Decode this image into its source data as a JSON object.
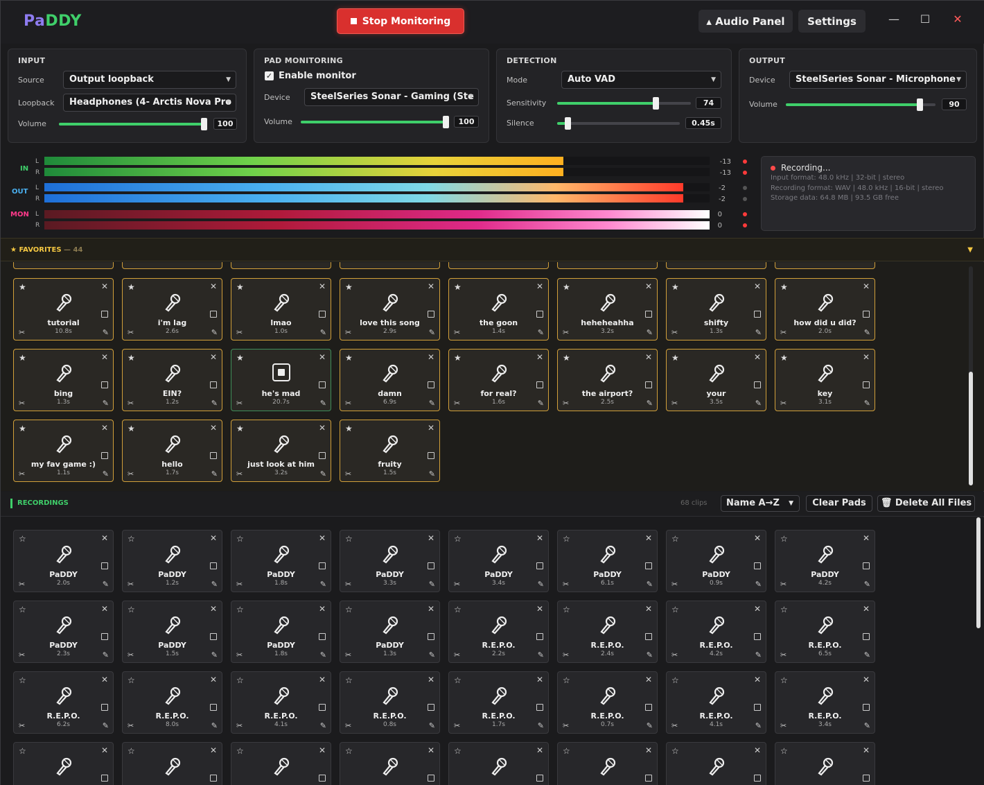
{
  "app": {
    "logo_a": "Pa",
    "logo_b": "DDY"
  },
  "titlebar": {
    "stop_label": "Stop Monitoring",
    "audio_panel_label": "▴ Audio Panel",
    "settings_label": "Settings",
    "minimize": "—",
    "maximize": "☐",
    "close": "✕"
  },
  "input": {
    "title": "INPUT",
    "source_label": "Source",
    "source_value": "Output loopback",
    "loopback_label": "Loopback",
    "loopback_value": "Headphones (4- Arctis Nova Pro",
    "volume_label": "Volume",
    "volume": "100",
    "volume_level": 100
  },
  "pad_monitoring": {
    "title": "PAD MONITORING",
    "enable_label": "Enable monitor",
    "enabled": true,
    "device_label": "Device",
    "device_value": "SteelSeries Sonar - Gaming (Ste",
    "volume_label": "Volume",
    "volume": "100",
    "volume_level": 100
  },
  "detection": {
    "title": "DETECTION",
    "mode_label": "Mode",
    "mode_value": "Auto VAD",
    "sensitivity_label": "Sensitivity",
    "sensitivity": "74",
    "sensitivity_level": 74,
    "silence_label": "Silence",
    "silence": "0.45s",
    "silence_level": 0.09
  },
  "output": {
    "title": "OUTPUT",
    "device_label": "Device",
    "device_value": "SteelSeries Sonar - Microphone",
    "volume_label": "Volume",
    "volume": "90",
    "volume_level": 90
  },
  "meters": {
    "in_label": "IN",
    "out_label": "OUT",
    "mon_label": "MON",
    "l": "L",
    "r": "R",
    "in_l_db": "-13",
    "in_r_db": "-13",
    "out_l_db": "-2",
    "out_r_db": "-2",
    "mon_l_db": "0",
    "mon_r_db": "0",
    "in_level": 0.78,
    "out_level": 0.96,
    "mon_level": 1.0
  },
  "recording_status": {
    "title": "Recording...",
    "input_format": "Input format: 48.0 kHz | 32-bit | stereo",
    "recording_format": "Recording format: WAV | 48.0 kHz | 16-bit | stereo",
    "storage": "Storage data: 64.8 MB | 93.5 GB free"
  },
  "favorites": {
    "title": "★ FAVORITES",
    "count": " — 44",
    "collapse": "▼",
    "pads": [
      {
        "name": "tutorial",
        "dur": "10.8s"
      },
      {
        "name": "i'm lag",
        "dur": "2.6s"
      },
      {
        "name": "lmao",
        "dur": "1.0s"
      },
      {
        "name": "love this song",
        "dur": "2.9s"
      },
      {
        "name": "the goon",
        "dur": "1.4s"
      },
      {
        "name": "heheheahha",
        "dur": "3.2s"
      },
      {
        "name": "shifty",
        "dur": "1.3s"
      },
      {
        "name": "how did u did?",
        "dur": "2.0s"
      },
      {
        "name": "bing",
        "dur": "1.3s"
      },
      {
        "name": "EIN?",
        "dur": "1.2s"
      },
      {
        "name": "he's mad",
        "dur": "20.7s",
        "playing": true
      },
      {
        "name": "damn",
        "dur": "6.9s"
      },
      {
        "name": "for real?",
        "dur": "1.6s"
      },
      {
        "name": "the airport?",
        "dur": "2.5s"
      },
      {
        "name": "your",
        "dur": "3.5s"
      },
      {
        "name": "key",
        "dur": "3.1s"
      },
      {
        "name": "my fav game :)",
        "dur": "1.1s"
      },
      {
        "name": "hello",
        "dur": "1.7s"
      },
      {
        "name": "just look at him",
        "dur": "3.2s"
      },
      {
        "name": "fruity",
        "dur": "1.5s"
      }
    ]
  },
  "recordings": {
    "title": "RECORDINGS",
    "count": "68 clips",
    "sort_value": "Name A→Z",
    "clear_label": "Clear Pads",
    "delete_label": "🗑 Delete All Files",
    "pads": [
      {
        "name": "PaDDY",
        "dur": "2.0s"
      },
      {
        "name": "PaDDY",
        "dur": "1.2s"
      },
      {
        "name": "PaDDY",
        "dur": "1.8s"
      },
      {
        "name": "PaDDY",
        "dur": "3.3s"
      },
      {
        "name": "PaDDY",
        "dur": "3.4s"
      },
      {
        "name": "PaDDY",
        "dur": "6.1s"
      },
      {
        "name": "PaDDY",
        "dur": "0.9s"
      },
      {
        "name": "PaDDY",
        "dur": "4.2s"
      },
      {
        "name": "PaDDY",
        "dur": "2.3s"
      },
      {
        "name": "PaDDY",
        "dur": "1.5s"
      },
      {
        "name": "PaDDY",
        "dur": "1.8s"
      },
      {
        "name": "PaDDY",
        "dur": "1.3s"
      },
      {
        "name": "R.E.P.O.",
        "dur": "2.2s"
      },
      {
        "name": "R.E.P.O.",
        "dur": "2.4s"
      },
      {
        "name": "R.E.P.O.",
        "dur": "4.2s"
      },
      {
        "name": "R.E.P.O.",
        "dur": "6.5s"
      },
      {
        "name": "R.E.P.O.",
        "dur": "6.2s"
      },
      {
        "name": "R.E.P.O.",
        "dur": "8.0s"
      },
      {
        "name": "R.E.P.O.",
        "dur": "4.1s"
      },
      {
        "name": "R.E.P.O.",
        "dur": "0.8s"
      },
      {
        "name": "R.E.P.O.",
        "dur": "1.7s"
      },
      {
        "name": "R.E.P.O.",
        "dur": "0.7s"
      },
      {
        "name": "R.E.P.O.",
        "dur": "4.1s"
      },
      {
        "name": "R.E.P.O.",
        "dur": "3.4s"
      },
      {
        "name": "",
        "dur": ""
      },
      {
        "name": "",
        "dur": ""
      },
      {
        "name": "",
        "dur": ""
      },
      {
        "name": "",
        "dur": ""
      },
      {
        "name": "",
        "dur": ""
      },
      {
        "name": "",
        "dur": ""
      },
      {
        "name": "",
        "dur": ""
      },
      {
        "name": "",
        "dur": ""
      }
    ]
  },
  "icons": {
    "star": "★",
    "star_outline": "☆",
    "close": "✕",
    "scissors": "✂",
    "edit": "✎"
  },
  "colors": {
    "accent_green": "#3fcf6a",
    "stop_red": "#d9302e",
    "favorite_gold": "#d2a03a",
    "logo_purple": "#8e7cf0"
  }
}
